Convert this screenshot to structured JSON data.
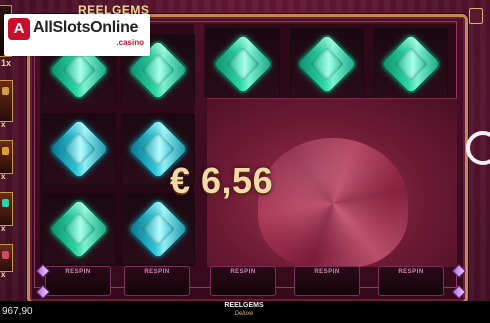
{
  "game": {
    "title": "REELGEMS",
    "brand_line1": "REELGEMS",
    "brand_line2": "Deluxe"
  },
  "win": {
    "amount": "€ 6,56"
  },
  "balance": {
    "value": "967,90"
  },
  "respin_labels": [
    "RESPIN",
    "RESPIN",
    "RESPIN",
    "RESPIN",
    "RESPIN"
  ],
  "left_multipliers": [
    {
      "label": "1x"
    },
    {
      "label": "x"
    },
    {
      "label": "x"
    },
    {
      "label": "x"
    },
    {
      "label": "x"
    },
    {
      "label": "x"
    }
  ],
  "watermark": {
    "text": "AllSlotsOnline",
    "sub": ".casino",
    "badge": "A"
  },
  "colors": {
    "background": "#3a0f22",
    "frame": "#c18a52",
    "gem": "#28d6a4",
    "win_text": "#f2d9a6"
  }
}
